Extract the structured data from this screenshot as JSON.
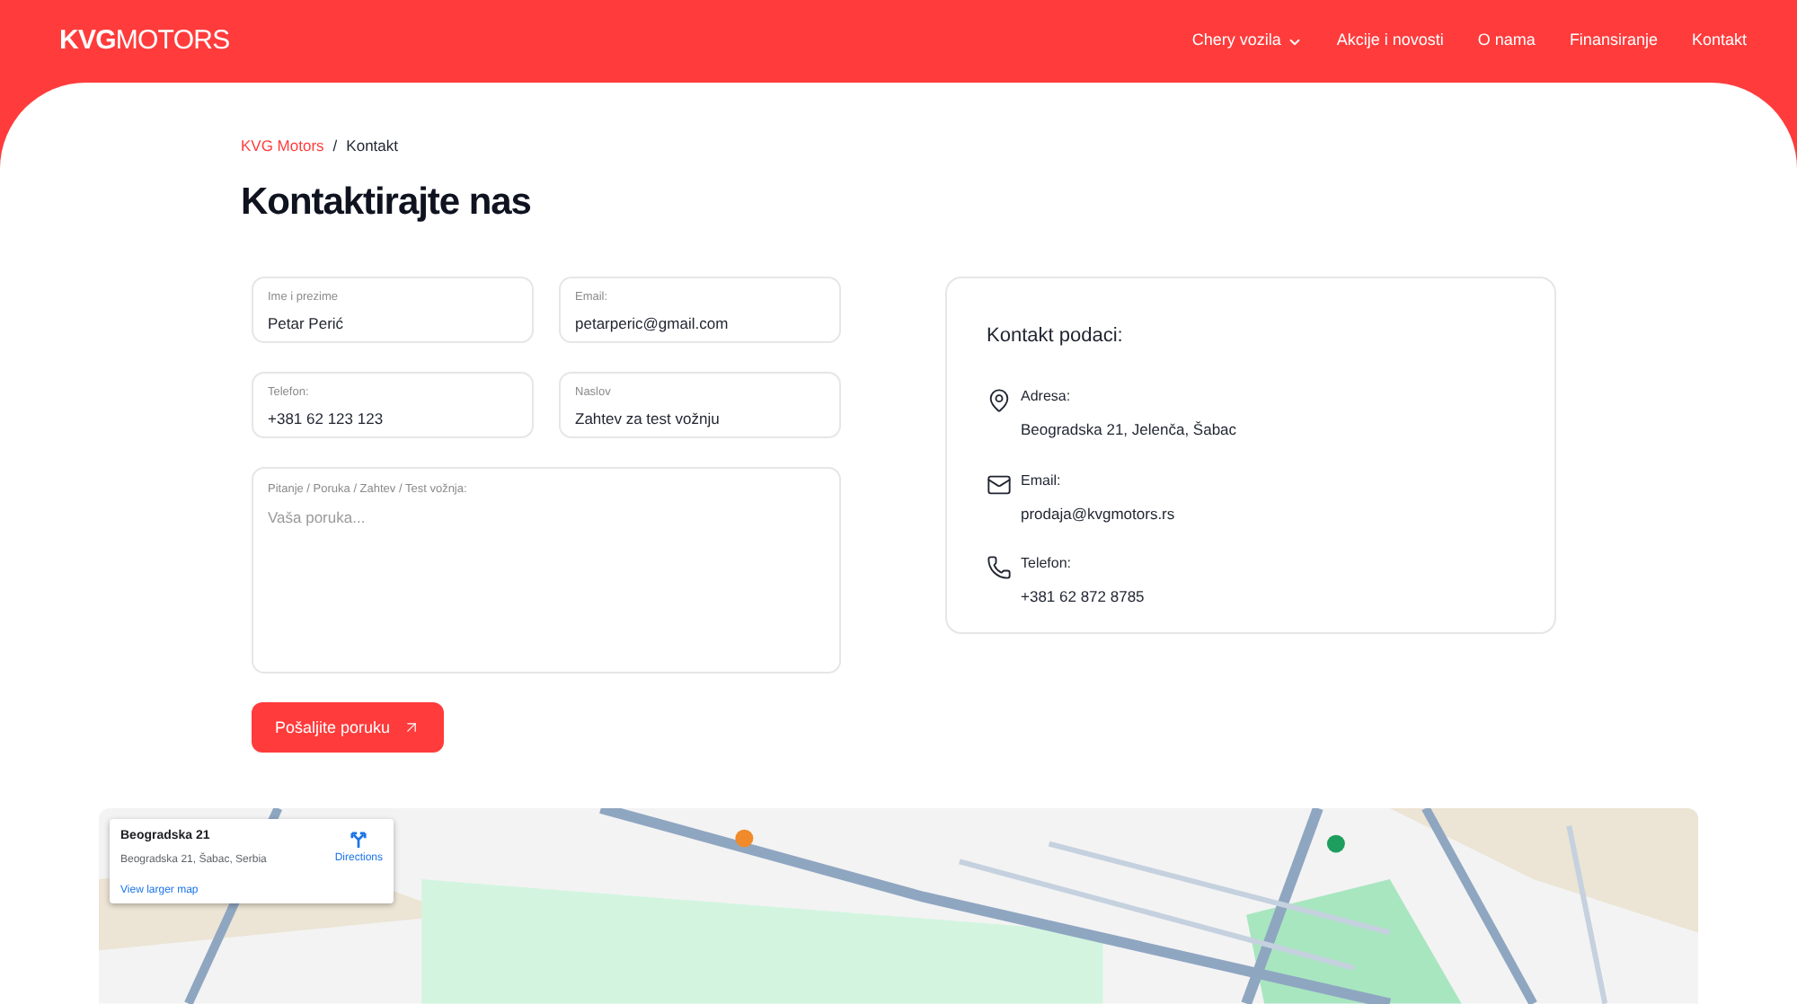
{
  "header": {
    "logo_bold": "KVG",
    "logo_light": "MOTORS",
    "nav": [
      {
        "label": "Chery vozila",
        "dropdown": true
      },
      {
        "label": "Akcije i novosti",
        "dropdown": false
      },
      {
        "label": "O nama",
        "dropdown": false
      },
      {
        "label": "Finansiranje",
        "dropdown": false
      },
      {
        "label": "Kontakt",
        "dropdown": false
      }
    ]
  },
  "breadcrumb": [
    {
      "label": "KVG Motors",
      "link": true
    },
    {
      "label": "Kontakt",
      "link": false
    }
  ],
  "breadcrumb_separator": "/",
  "title": "Kontaktirajte nas",
  "form": {
    "fields": [
      {
        "label": "Ime i prezime",
        "value": "Petar Perić"
      },
      {
        "label": "Email:",
        "value": "petarperic@gmail.com"
      },
      {
        "label": "Telefon:",
        "value": "+381 62 123 123"
      },
      {
        "label": "Naslov",
        "value": "Zahtev za test vožnju"
      }
    ],
    "message": {
      "label": "Pitanje / Poruka / Zahtev / Test vožnja:",
      "placeholder": "Vaša poruka..."
    },
    "submit": "Pošaljite poruku"
  },
  "contact": {
    "title": "Kontakt podaci:",
    "items": [
      {
        "kind": "address",
        "label": "Adresa:",
        "value": "Beogradska 21, Jelenča, Šabac"
      },
      {
        "kind": "email",
        "label": "Email:",
        "value": "prodaja@kvgmotors.rs"
      },
      {
        "kind": "phone",
        "label": "Telefon:",
        "value": "+381 62 872 8785"
      }
    ]
  },
  "map": {
    "kind": "picture",
    "card": {
      "title": "Beogradska 21",
      "address": "Beogradska 21, Šabac, Serbia",
      "directions": "Directions",
      "link": "View larger map"
    }
  }
}
